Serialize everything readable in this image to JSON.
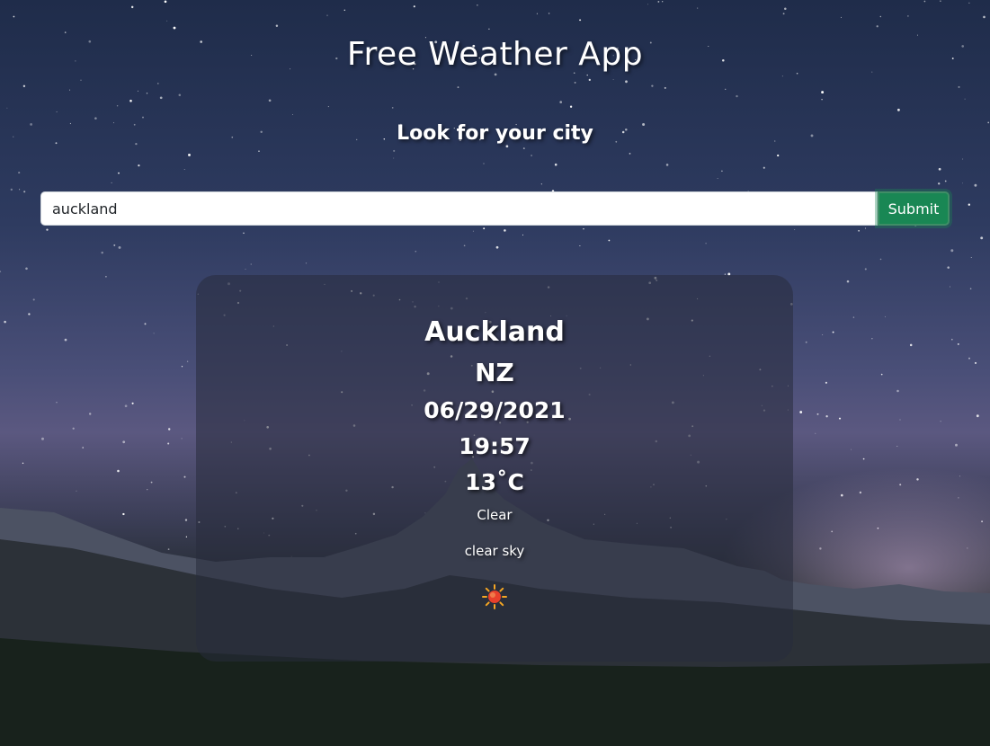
{
  "header": {
    "title": "Free Weather App",
    "subtitle": "Look for your city"
  },
  "search": {
    "value": "auckland",
    "submit_label": "Submit"
  },
  "weather": {
    "city": "Auckland",
    "country": "NZ",
    "date": "06/29/2021",
    "time": "19:57",
    "temperature": "13˚C",
    "main": "Clear",
    "description": "clear sky",
    "icon": "sun-icon"
  },
  "colors": {
    "submit_button": "#198754",
    "text": "#ffffff"
  }
}
